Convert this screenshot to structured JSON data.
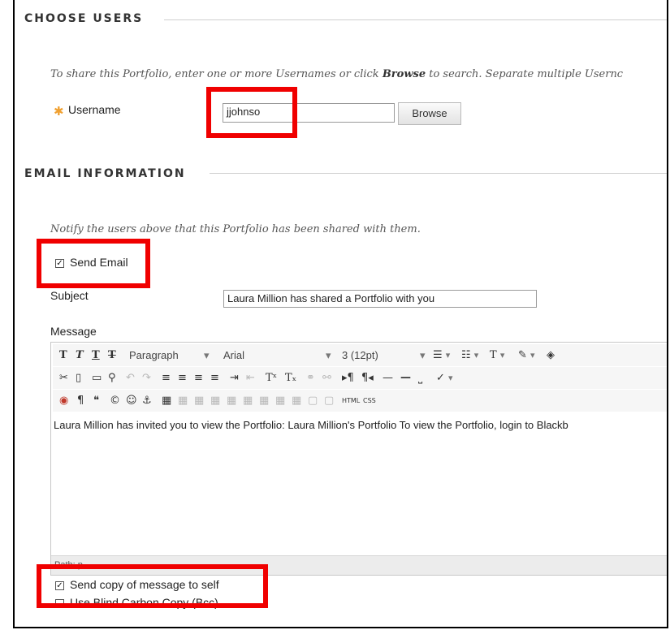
{
  "choose_users": {
    "title": "CHOOSE USERS",
    "instructions_pre": "To share this Portfolio, enter one or more Usernames or click ",
    "instructions_bold": "Browse",
    "instructions_post": " to search. Separate multiple Usernc",
    "required_mark": "✱",
    "username_label": "Username",
    "username_value": "jjohnso",
    "browse_label": "Browse"
  },
  "email_info": {
    "title": "EMAIL INFORMATION",
    "notify_text": "Notify the users above that this Portfolio has been shared with them.",
    "send_email_label": "Send Email",
    "send_email_checked": true,
    "subject_label": "Subject",
    "subject_value": "Laura Million has shared a Portfolio with you",
    "message_label": "Message",
    "editor": {
      "paragraph_label": "Paragraph",
      "font_label": "Arial",
      "size_label": "3 (12pt)",
      "body_text": "Laura Million has invited you to view the Portfolio: Laura Million's Portfolio To view the Portfolio, login to Blackb",
      "path_label": "Path: p",
      "html_label": "HTML",
      "css_label": "CSS"
    },
    "copy_self_label": "Send copy of message to self",
    "copy_self_checked": true,
    "bcc_label": "Use Blind Carbon Copy (Bcc)",
    "bcc_checked": false
  },
  "colors": {
    "highlight": "#f00000",
    "required_star": "#f0a030"
  }
}
